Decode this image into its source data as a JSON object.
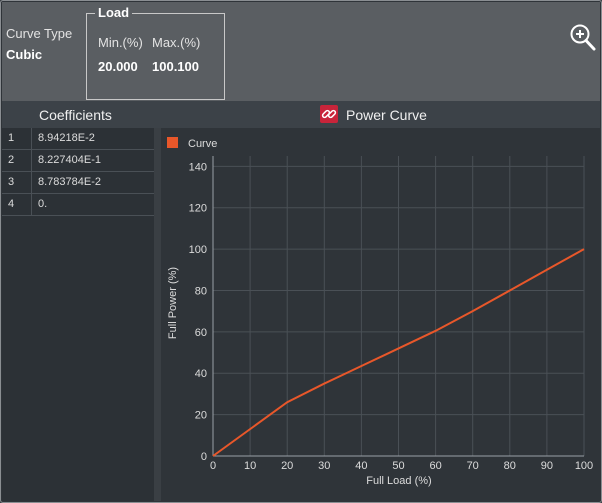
{
  "curve_type": {
    "label": "Curve Type",
    "value": "Cubic"
  },
  "load": {
    "title": "Load",
    "min_label": "Min.(%)",
    "max_label": "Max.(%)",
    "min_value": "20.000",
    "max_value": "100.100"
  },
  "toolbar": {
    "zoom_icon": "zoom-in-icon"
  },
  "coefficients": {
    "header": "Coefficients",
    "rows": [
      {
        "index": "1",
        "value": "8.94218E-2"
      },
      {
        "index": "2",
        "value": "8.227404E-1"
      },
      {
        "index": "3",
        "value": "8.783784E-2"
      },
      {
        "index": "4",
        "value": "0."
      }
    ]
  },
  "power_curve": {
    "header": "Power Curve",
    "icon": "link-icon"
  },
  "colors": {
    "curve": "#e8572a",
    "icon_bg": "#c8243a"
  },
  "chart_data": {
    "type": "line",
    "legend": [
      "Curve"
    ],
    "legend_placement": "top-left",
    "xlabel": "Full Load (%)",
    "ylabel": "Full Power (%)",
    "xlim": [
      0,
      100
    ],
    "ylim": [
      0,
      145
    ],
    "xticks": [
      0,
      10,
      20,
      30,
      40,
      50,
      60,
      70,
      80,
      90,
      100
    ],
    "yticks": [
      0,
      20,
      40,
      60,
      80,
      100,
      120,
      140
    ],
    "grid": true,
    "series": [
      {
        "name": "Curve",
        "x": [
          0,
          20,
          30,
          40,
          50,
          60,
          70,
          80,
          90,
          100
        ],
        "y": [
          0,
          26,
          35,
          43.5,
          52,
          60.5,
          70,
          80,
          90,
          100
        ]
      }
    ]
  }
}
